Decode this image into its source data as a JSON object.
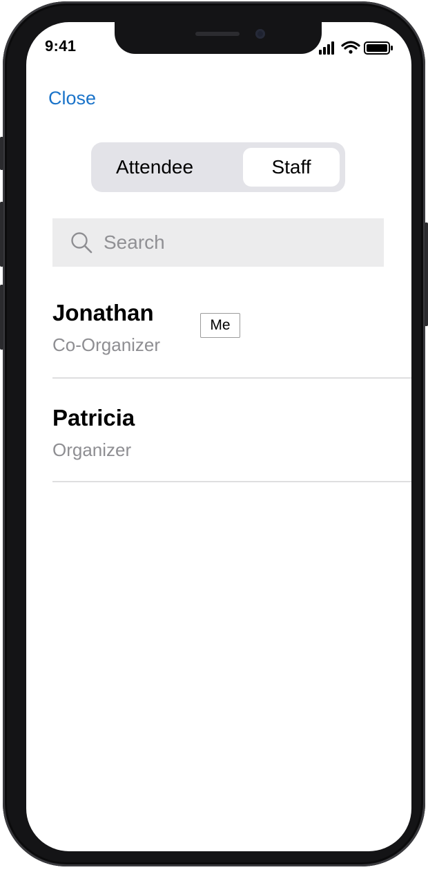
{
  "status_bar": {
    "time": "9:41",
    "icons": [
      "cellular-signal-icon",
      "wifi-icon",
      "battery-icon"
    ]
  },
  "header": {
    "close_label": "Close",
    "accent_color": "#1a73c9"
  },
  "segmented_control": {
    "options": [
      {
        "label": "Attendee",
        "selected": false
      },
      {
        "label": "Staff",
        "selected": true
      }
    ]
  },
  "search": {
    "placeholder": "Search",
    "value": "",
    "icon": "search-icon"
  },
  "list": {
    "items": [
      {
        "name": "Jonathan",
        "role": "Co-Organizer",
        "badge": "Me"
      },
      {
        "name": "Patricia",
        "role": "Organizer"
      }
    ]
  }
}
